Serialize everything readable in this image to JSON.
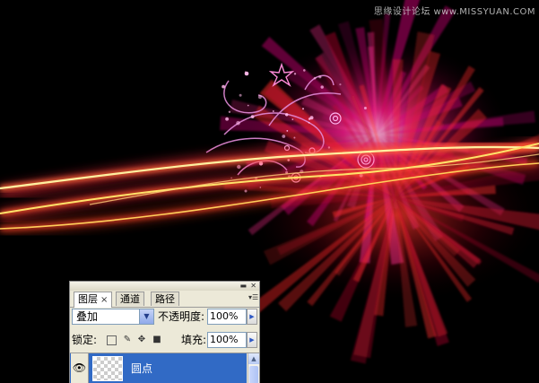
{
  "watermark": "思缘设计论坛 www.MISSYUAN.COM",
  "panel": {
    "tabs": [
      {
        "label": "图层",
        "active": true
      },
      {
        "label": "通道",
        "active": false
      },
      {
        "label": "路径",
        "active": false
      }
    ],
    "tab_close_glyph": "×",
    "blend_mode": "叠加",
    "opacity_label": "不透明度:",
    "opacity_value": "100%",
    "lock_label": "锁定:",
    "fill_label": "填充:",
    "fill_value": "100%",
    "layers": [
      {
        "name": "圆点",
        "selected": true,
        "visible": true
      }
    ]
  },
  "colors": {
    "background": "#000000",
    "streak_yellow": "#ffe36a",
    "streak_red": "#ff2a3a",
    "burst_magenta": "#ff1a8c",
    "selection": "#316ac5"
  }
}
